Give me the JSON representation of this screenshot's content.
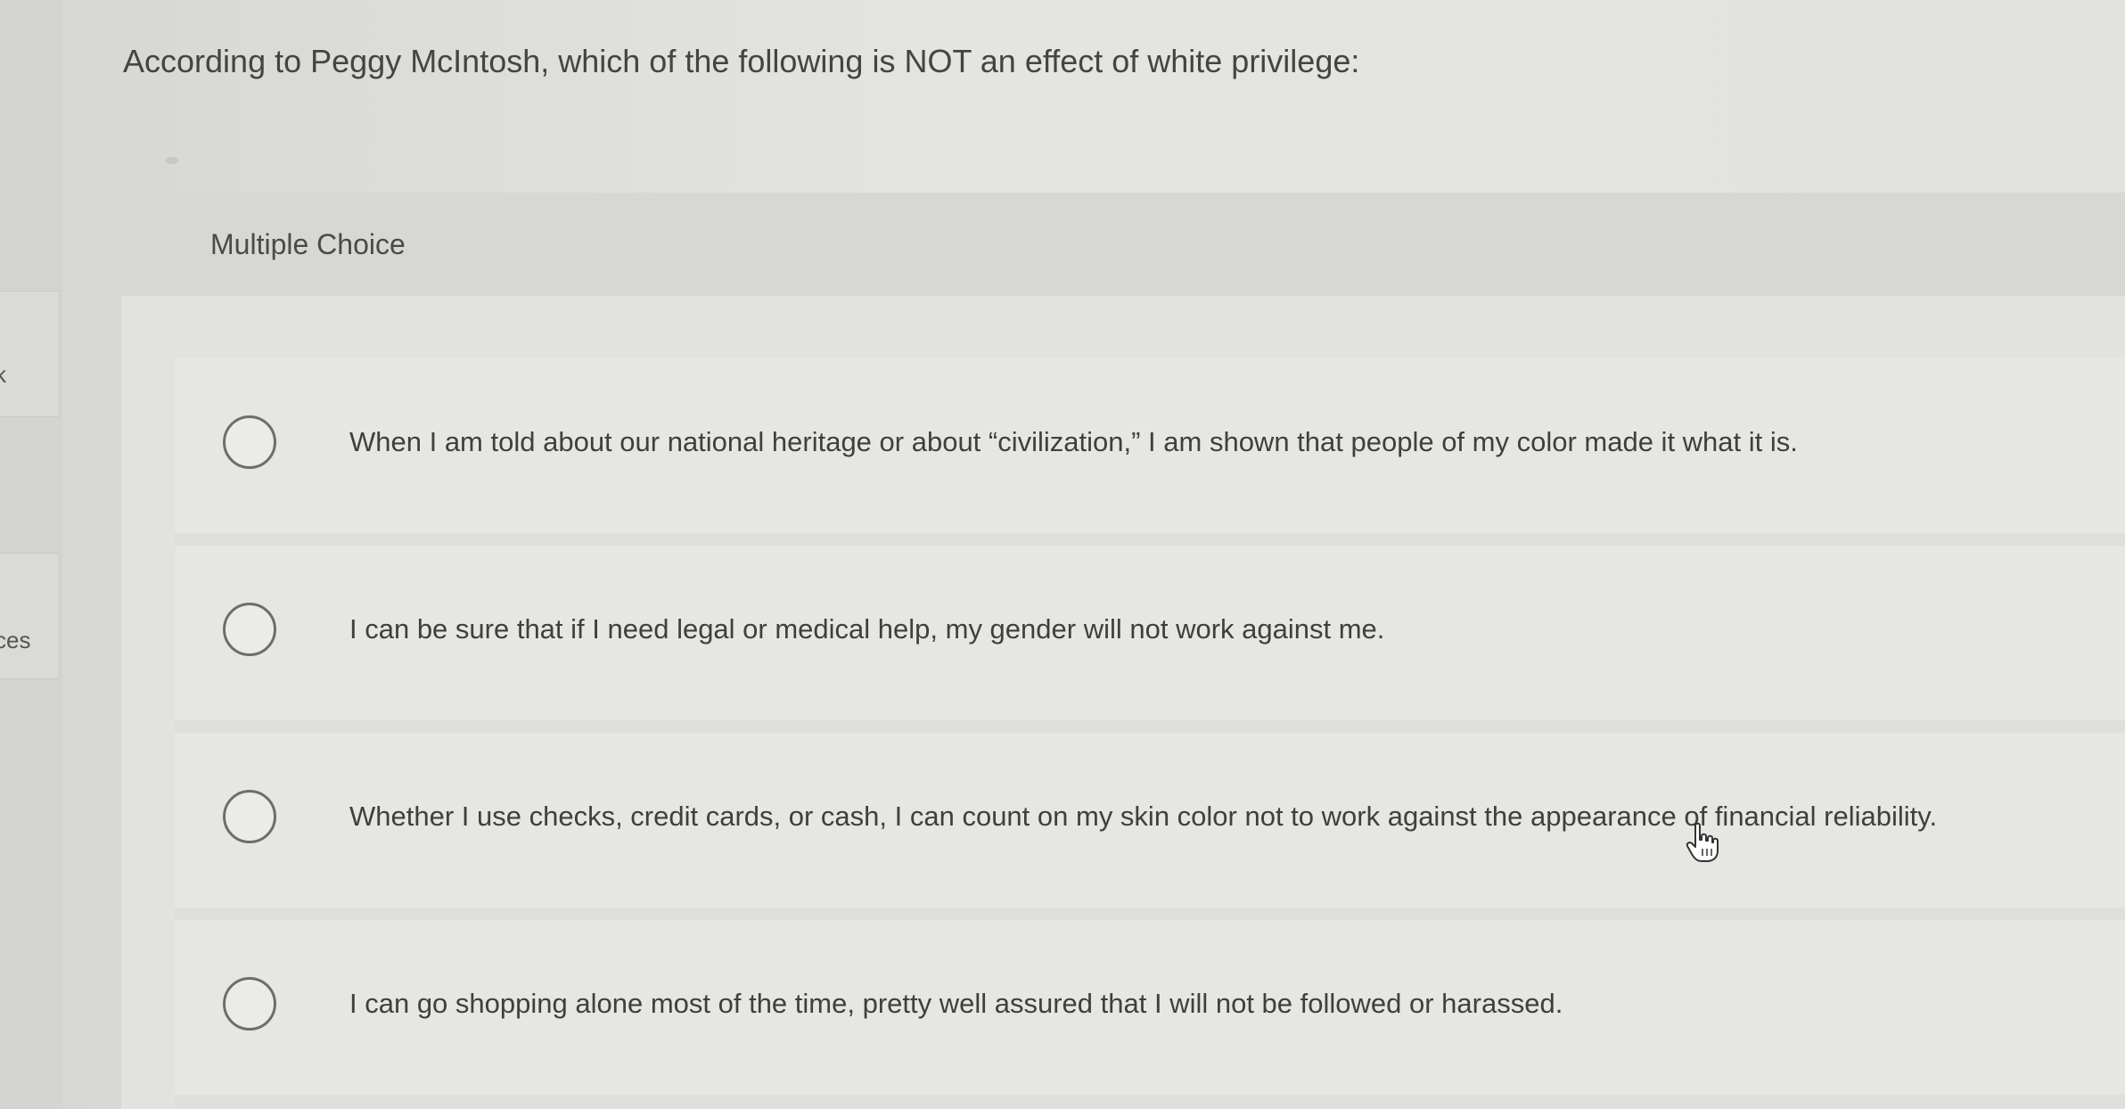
{
  "question": {
    "text": "According to Peggy McIntosh, which of the following is NOT an effect of white privilege:"
  },
  "panel": {
    "title": "Multiple Choice"
  },
  "choices": [
    {
      "label": "When I am told about our national heritage or about “civilization,” I am shown that people of my color made it what it is."
    },
    {
      "label": "I can be sure that if I need legal or medical help, my gender will not work against me."
    },
    {
      "label": "Whether I use checks, credit cards, or cash, I can count on my skin color not to work against the appearance of financial reliability."
    },
    {
      "label": "I can go shopping alone most of the time, pretty well assured that I will not be followed or harassed."
    }
  ],
  "sidebar": {
    "tab_top_label": "k",
    "tab_bottom_label": "ces"
  },
  "cursor": {
    "icon": "hand-pointer-icon"
  },
  "colors": {
    "background": "#e2e2de",
    "radio_border": "#6d6d6d",
    "text": "#3f3f3f"
  }
}
